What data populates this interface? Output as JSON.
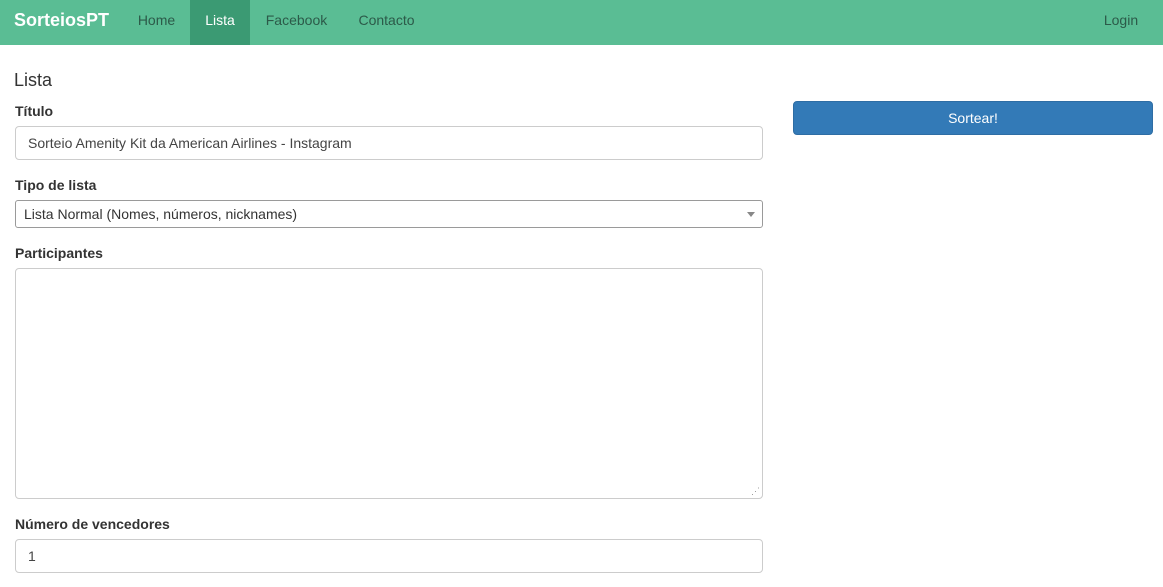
{
  "navbar": {
    "brand": "SorteiosPT",
    "items": [
      {
        "label": "Home",
        "active": false
      },
      {
        "label": "Lista",
        "active": true
      },
      {
        "label": "Facebook",
        "active": false
      },
      {
        "label": "Contacto",
        "active": false
      }
    ],
    "login": "Login"
  },
  "page": {
    "section_title": "Lista"
  },
  "form": {
    "titulo_label": "Título",
    "titulo_value": "Sorteio Amenity Kit da American Airlines - Instagram",
    "tipo_label": "Tipo de lista",
    "tipo_selected": "Lista Normal (Nomes, números, nicknames)",
    "participantes_label": "Participantes",
    "participantes_value": "",
    "vencedores_label": "Número de vencedores",
    "vencedores_value": "1"
  },
  "actions": {
    "sortear_label": "Sortear!"
  },
  "colors": {
    "navbar_bg": "#5abd94",
    "nav_active_bg": "#3b9a73",
    "primary_button": "#337ab7"
  }
}
